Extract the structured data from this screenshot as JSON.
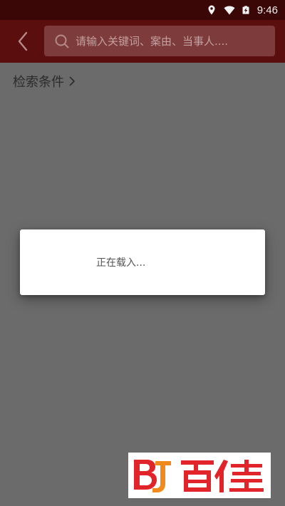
{
  "status_bar": {
    "time": "9:46",
    "icons": [
      "location-icon",
      "wifi-icon",
      "battery-charging-icon"
    ]
  },
  "header": {
    "back_icon": "chevron-left-icon",
    "search": {
      "placeholder": "请输入关键词、案由、当事人....",
      "value": ""
    }
  },
  "filter": {
    "label": "检索条件"
  },
  "dialog": {
    "message": "正在载入..."
  },
  "watermark": {
    "text": "百佳",
    "logo_mark": "BJ"
  },
  "colors": {
    "status_bar_bg": "#3a0606",
    "header_bg": "#5a0e0e",
    "search_bg": "#7e3b3b",
    "overlay_bg": "#6b6b6b",
    "brand_red": "#e0242a"
  }
}
